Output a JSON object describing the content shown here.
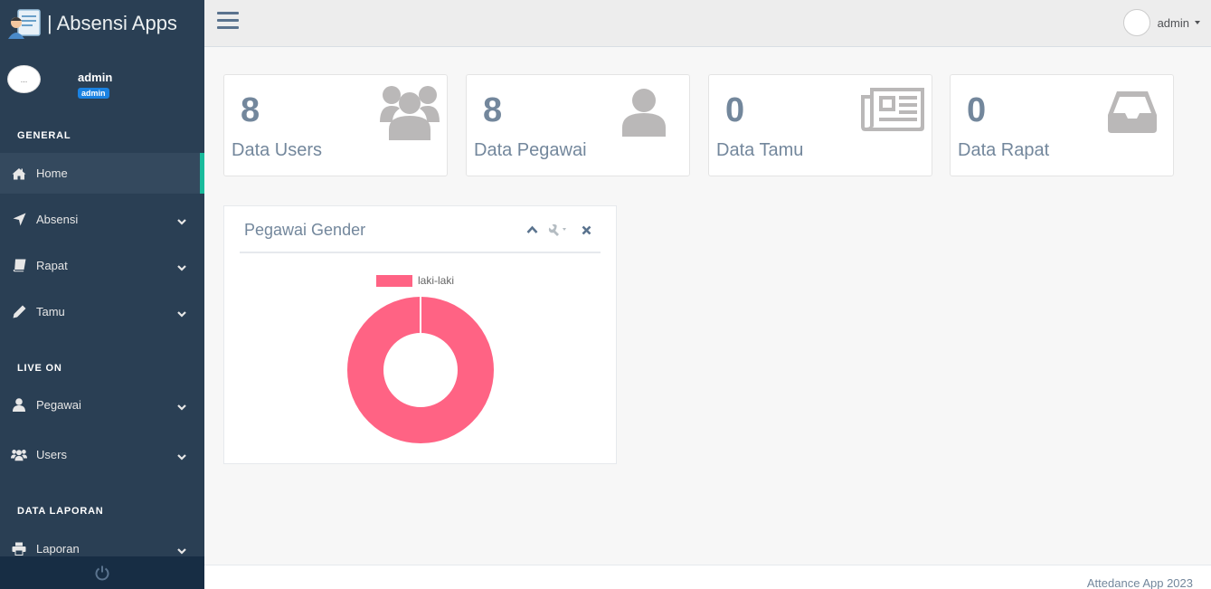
{
  "brand": {
    "title": "| Absensi Apps"
  },
  "profile": {
    "avatar_alt": "...",
    "name": "admin",
    "badge": "admin"
  },
  "sidebar": {
    "sections": [
      {
        "title": "GENERAL"
      },
      {
        "title": "LIVE ON"
      },
      {
        "title": "DATA LAPORAN"
      }
    ],
    "items": [
      {
        "label": "Home",
        "icon": "home-icon",
        "active": true
      },
      {
        "label": "Absensi",
        "icon": "location-arrow-icon"
      },
      {
        "label": "Rapat",
        "icon": "book-icon"
      },
      {
        "label": "Tamu",
        "icon": "pencil-icon"
      },
      {
        "label": "Pegawai",
        "icon": "user-icon"
      },
      {
        "label": "Users",
        "icon": "users-icon"
      },
      {
        "label": "Laporan",
        "icon": "print-icon"
      }
    ],
    "footer_icon": "power-icon"
  },
  "topnav": {
    "user_name": "admin"
  },
  "tiles": [
    {
      "count": "8",
      "label": "Data Users",
      "icon": "users-icon"
    },
    {
      "count": "8",
      "label": "Data Pegawai",
      "icon": "user-icon"
    },
    {
      "count": "0",
      "label": "Data Tamu",
      "icon": "newspaper-icon"
    },
    {
      "count": "0",
      "label": "Data Rapat",
      "icon": "inbox-icon"
    }
  ],
  "panel": {
    "title": "Pegawai Gender"
  },
  "chart_data": {
    "type": "pie",
    "variant": "doughnut",
    "categories": [
      "laki-laki"
    ],
    "values": [
      1
    ],
    "colors": [
      "#ff6384"
    ],
    "legend": "top"
  },
  "footer": {
    "text": "Attedance App 2023"
  }
}
